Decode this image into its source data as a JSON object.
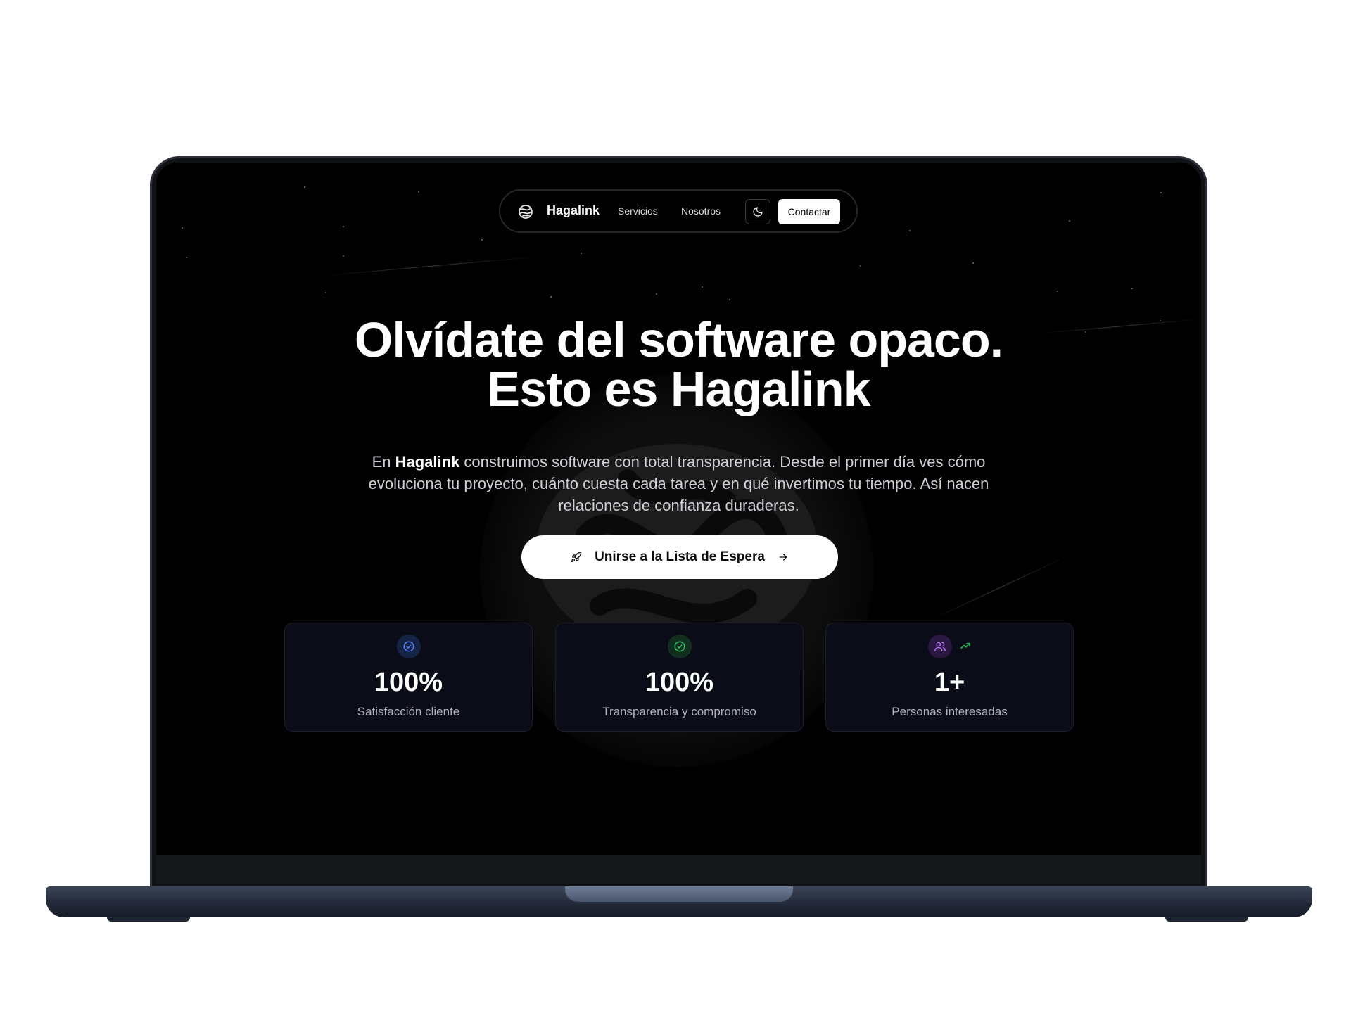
{
  "nav": {
    "brand": "Hagalink",
    "links": [
      "Servicios",
      "Nosotros"
    ],
    "contact_label": "Contactar"
  },
  "hero": {
    "title_line1": "Olvídate del software opaco.",
    "title_line2": "Esto es Hagalink",
    "subtitle_prefix": "En ",
    "subtitle_brand": "Hagalink",
    "subtitle_rest": " construimos software con total transparencia. Desde el primer día ves cómo evoluciona tu proyecto, cuánto cuesta cada tarea y en qué invertimos tu tiempo. Así nacen relaciones de confianza duraderas.",
    "cta_label": "Unirse a la Lista de Espera"
  },
  "stats": [
    {
      "value": "100%",
      "label": "Satisfacción cliente",
      "icon": "check-circle-icon",
      "color": "#4f7dff"
    },
    {
      "value": "100%",
      "label": "Transparencia y compromiso",
      "icon": "check-circle-icon",
      "color": "#34c36b"
    },
    {
      "value": "1+",
      "label": "Personas interesadas",
      "icon": "users-icon",
      "color": "#b06cf0"
    }
  ],
  "colors": {
    "background": "#000000",
    "accent_trend": "#22c55e"
  }
}
